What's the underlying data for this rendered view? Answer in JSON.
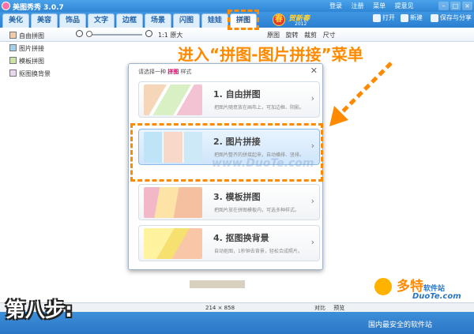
{
  "titlebar": {
    "title": "美图秀秀 3.0.7",
    "links": [
      "登录",
      "注册",
      "菜单",
      "提意见"
    ]
  },
  "tabs": [
    "美化",
    "美容",
    "饰品",
    "文字",
    "边框",
    "场景",
    "闪图",
    "娃娃",
    "拼图"
  ],
  "active_tab": "拼图",
  "festive": {
    "badge": "春",
    "text": "贺新春",
    "year": "2012"
  },
  "right_buttons": {
    "open": "打开",
    "new": "新建",
    "save": "保存与分享"
  },
  "toolbar": {
    "orig_size": "1:1 原大",
    "tools": [
      "原图",
      "旋转",
      "裁剪",
      "尺寸"
    ]
  },
  "left_panel": [
    "自由拼图",
    "图片拼接",
    "模板拼图",
    "抠图换背景"
  ],
  "instruction": "进入“拼图-图片拼接”菜单",
  "dialog": {
    "header_prefix": "请选择一种",
    "header_highlight": "拼图",
    "header_suffix": "样式",
    "options": [
      {
        "title": "1. 自由拼图",
        "desc": "把图片随意放在画布上，可加边框、阴影。"
      },
      {
        "title": "2. 图片拼接",
        "desc": "把图片整齐的拼接起来，自动横排、竖排。"
      },
      {
        "title": "3. 模板拼图",
        "desc": "把图片放在拼图模板内，可选多种样式。"
      },
      {
        "title": "4. 抠图换背景",
        "desc": "自动抠图，1秒钟去背景，轻松合成照片。"
      }
    ]
  },
  "watermark": "www.DuoTe.com",
  "status": {
    "dims": "214 × 858",
    "compare": "对比",
    "preview": "预览"
  },
  "step_label": "第八步:",
  "brand": {
    "name": "多特",
    "suffix": "软件站",
    "url": "DuoTe.com",
    "slogan": "国内最安全的软件站"
  },
  "colors": {
    "accent_orange": "#ff8a00",
    "title_blue": "#2f86d6",
    "selected_bg": "#cfe5fb"
  }
}
